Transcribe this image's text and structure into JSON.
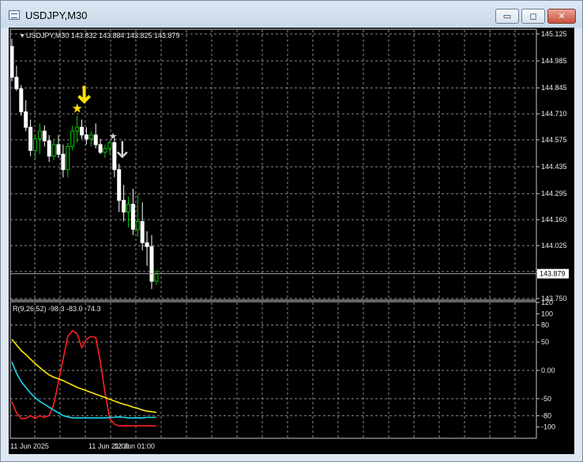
{
  "window": {
    "title": "USDJPY,M30",
    "buttons": {
      "minimize": "▭",
      "maximize": "◻",
      "close": "✕"
    }
  },
  "chart": {
    "symbol_label": "USDJPY,M30",
    "ohlc": "143.832 143.884 143.825 143.879",
    "current_price": "143.879",
    "current_price_value": 143.879,
    "price_range": [
      143.75,
      145.125
    ],
    "price_ticks": [
      "145.125",
      "144.985",
      "144.845",
      "144.710",
      "144.575",
      "144.435",
      "144.295",
      "144.160",
      "144.025",
      "143.890",
      "143.750"
    ],
    "time_labels": [
      "11 Jun 2025",
      "11 Jun 21:00",
      "12 Jun 01:00"
    ],
    "colors": {
      "up": "#00c800",
      "down": "#ffffff",
      "grid": "#8a8a8a",
      "signal_buy": "#ffe000",
      "signal_sell": "#d0d0d0"
    },
    "candles": [
      [
        145.06,
        145.1,
        144.88,
        144.9
      ],
      [
        144.9,
        144.96,
        144.83,
        144.84
      ],
      [
        144.84,
        144.86,
        144.7,
        144.72
      ],
      [
        144.72,
        144.78,
        144.62,
        144.64
      ],
      [
        144.64,
        144.68,
        144.49,
        144.52
      ],
      [
        144.52,
        144.6,
        144.47,
        144.58
      ],
      [
        144.58,
        144.66,
        144.5,
        144.62
      ],
      [
        144.62,
        144.65,
        144.54,
        144.57
      ],
      [
        144.57,
        144.6,
        144.46,
        144.49
      ],
      [
        144.49,
        144.58,
        144.47,
        144.55
      ],
      [
        144.55,
        144.6,
        144.48,
        144.5
      ],
      [
        144.5,
        144.55,
        144.38,
        144.42
      ],
      [
        144.42,
        144.56,
        144.38,
        144.54
      ],
      [
        144.54,
        144.65,
        144.52,
        144.62
      ],
      [
        144.62,
        144.7,
        144.56,
        144.64
      ],
      [
        144.64,
        144.68,
        144.58,
        144.6
      ],
      [
        144.6,
        144.64,
        144.55,
        144.58
      ],
      [
        144.58,
        144.62,
        144.54,
        144.6
      ],
      [
        144.6,
        144.66,
        144.53,
        144.55
      ],
      [
        144.55,
        144.58,
        144.5,
        144.51
      ],
      [
        144.51,
        144.55,
        144.48,
        144.53
      ],
      [
        144.53,
        144.57,
        144.5,
        144.56
      ],
      [
        144.56,
        144.58,
        144.38,
        144.42
      ],
      [
        144.42,
        144.45,
        144.2,
        144.26
      ],
      [
        144.26,
        144.34,
        144.15,
        144.2
      ],
      [
        144.2,
        144.28,
        144.12,
        144.24
      ],
      [
        144.24,
        144.32,
        144.08,
        144.11
      ],
      [
        144.11,
        144.29,
        144.07,
        144.15
      ],
      [
        144.15,
        144.25,
        144.0,
        144.04
      ],
      [
        144.04,
        144.1,
        143.92,
        144.02
      ],
      [
        144.02,
        144.08,
        143.8,
        143.84
      ],
      [
        143.84,
        143.9,
        143.82,
        143.88
      ]
    ],
    "signals": [
      {
        "type": "buy",
        "candle": 14,
        "price": 144.7
      },
      {
        "type": "sell",
        "candle": 22,
        "price": 144.56
      }
    ]
  },
  "indicator": {
    "label": "R(9,26,52) -98.3 -83.0 -74.3",
    "range": [
      -120,
      120
    ],
    "ticks": [
      "120",
      "100",
      "80",
      "50",
      "0.00",
      "-50",
      "-80",
      "-100"
    ],
    "tick_values": [
      120,
      100,
      80,
      50,
      0,
      -50,
      -80,
      -100
    ],
    "levels": [
      80,
      50,
      -50,
      -80
    ],
    "series": [
      {
        "color": "#ff2020",
        "values": [
          -55,
          -75,
          -85,
          -85,
          -80,
          -85,
          -80,
          -83,
          -80,
          -60,
          -20,
          20,
          60,
          70,
          65,
          40,
          55,
          60,
          58,
          15,
          -40,
          -85,
          -95,
          -98,
          -98,
          -98,
          -98,
          -98,
          -98,
          -98,
          -98,
          -98.3
        ]
      },
      {
        "color": "#20d8f0",
        "values": [
          15,
          -5,
          -20,
          -30,
          -40,
          -48,
          -55,
          -60,
          -65,
          -70,
          -75,
          -80,
          -82,
          -84,
          -84,
          -84,
          -84,
          -84,
          -84,
          -84,
          -84,
          -83,
          -83,
          -82,
          -83,
          -84,
          -84,
          -84,
          -84,
          -83,
          -83,
          -83.0
        ]
      },
      {
        "color": "#ffe600",
        "values": [
          55,
          45,
          35,
          28,
          20,
          12,
          5,
          -2,
          -8,
          -12,
          -15,
          -18,
          -22,
          -26,
          -30,
          -33,
          -36,
          -39,
          -42,
          -45,
          -48,
          -51,
          -54,
          -57,
          -60,
          -62,
          -65,
          -67,
          -70,
          -72,
          -73,
          -74.3
        ]
      }
    ]
  }
}
